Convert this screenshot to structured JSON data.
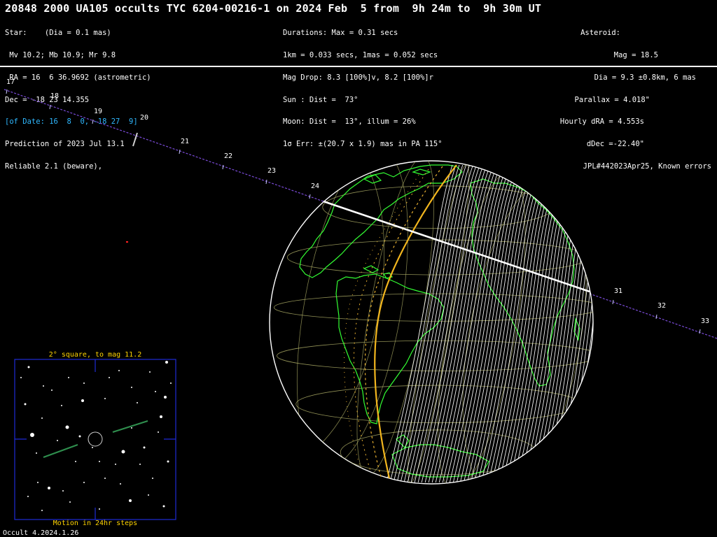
{
  "title": "20848 2000 UA105 occults TYC 6204-00216-1 on 2024 Feb  5 from  9h 24m to  9h 30m UT",
  "left_panel": {
    "star_heading": "Star:    (Dia = 0.1 mas)",
    "mags": " Mv 10.2; Mb 10.9; Mr 9.8",
    "ra": " RA = 16  6 36.9692 (astrometric)",
    "dec": "Dec = -18 23 14.355",
    "of_date": "[of Date: 16  8  0, -18 27  9]",
    "prediction": "Prediction of 2023 Jul 13.1",
    "reliable": "Reliable 2.1 (beware),"
  },
  "mid_panel": {
    "durations": "Durations: Max = 0.31 secs",
    "scale": "1km = 0.033 secs, 1mas = 0.052 secs",
    "mag_drop": "Mag Drop: 8.3 [100%]v, 8.2 [100%]r",
    "sun": "Sun : Dist =  73°",
    "moon": "Moon: Dist =  13°, illum = 26%",
    "error": "1σ Err: ±(20.7 x 1.9) mas in PA 115°"
  },
  "right_panel": {
    "asteroid_heading": "Asteroid:",
    "mag": "Mag = 18.5",
    "dia": "Dia = 9.3 ±0.8km, 6 mas",
    "parallax": "Parallax = 4.018\"",
    "hourly_dra": "Hourly dRA = 4.553s",
    "ddec": "dDec =-22.40\"",
    "ephem": "JPL#442023Apr25, Known errors"
  },
  "path_ticks": [
    "17",
    "18",
    "19",
    "20",
    "21",
    "22",
    "23",
    "24",
    "31",
    "32",
    "33"
  ],
  "star_chart": {
    "title": "2° square, to mag 11.2",
    "caption": "Motion in 24hr steps"
  },
  "footer": "Occult 4.2024.1.26",
  "colors": {
    "background": "#000000",
    "globe_outline": "#ffffff",
    "coastline": "#33ff33",
    "grid": "#b4b46a",
    "shadow_path": "#ffffff",
    "limit_line": "#f2b61e",
    "track": "#7a4bd8",
    "chart_frame": "#1f2bd6",
    "chart_caption": "#ffd400",
    "motion": "#2f8f4e"
  }
}
